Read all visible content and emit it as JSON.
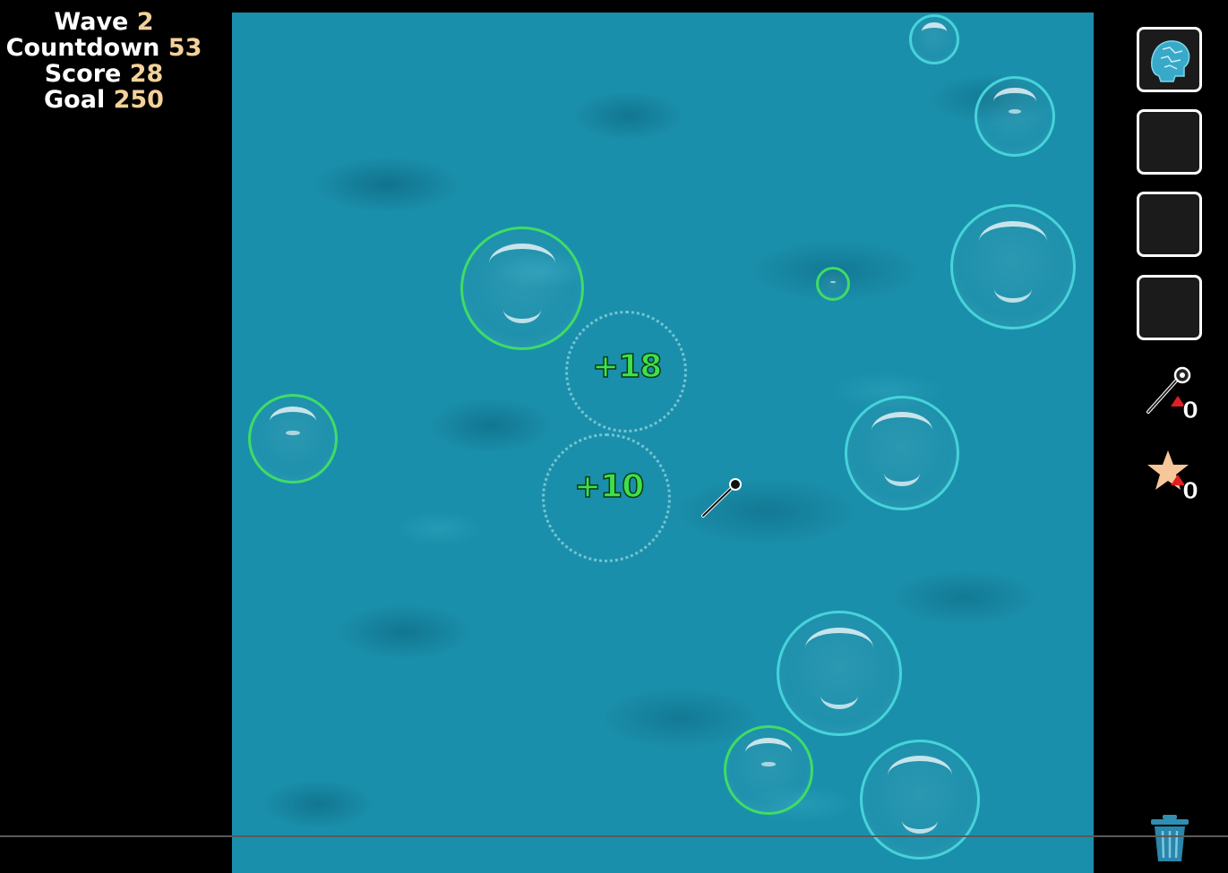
{
  "hud": {
    "wave_label": "Wave",
    "wave_value": "2",
    "countdown_label": "Countdown",
    "countdown_value": "53",
    "score_label": "Score",
    "score_value": "28",
    "goal_label": "Goal",
    "goal_value": "250"
  },
  "popups": [
    {
      "text": "+18"
    },
    {
      "text": "+10"
    }
  ],
  "sidebar": {
    "slot_1_icon": "brain-puzzle-icon",
    "pin_powerup": {
      "icon": "pin-icon",
      "count": "0"
    },
    "star_powerup": {
      "icon": "star-icon",
      "count": "0"
    },
    "trash_icon": "trash-icon"
  },
  "colors": {
    "water": "#1a8fab",
    "bubble_green": "#3fdc66",
    "bubble_cyan": "#46d3da",
    "hud_value": "#f2d19a",
    "popup_green": "#3fe04a",
    "star": "#f7c79a",
    "arrow_red": "#e02020"
  }
}
